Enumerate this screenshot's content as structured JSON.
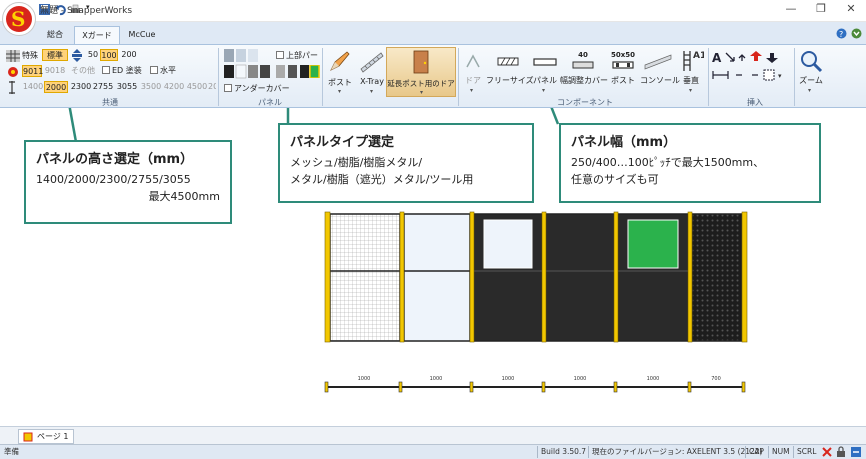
{
  "window": {
    "title": "無題 - SnapperWorks",
    "controls": [
      "minimize",
      "restore",
      "close"
    ]
  },
  "tabs": [
    {
      "label": "総合",
      "active": false
    },
    {
      "label": "Xガード",
      "active": true
    },
    {
      "label": "McCue",
      "active": false
    }
  ],
  "ribbon": {
    "common": {
      "row1": [
        "特殊",
        "標準",
        "50",
        "100",
        "200"
      ],
      "row2": [
        "9011",
        "9018",
        "その他"
      ],
      "row2_checks": [
        "ED 塗装",
        "水平"
      ],
      "heights": [
        "1400",
        "2000",
        "2300",
        "2755",
        "3055",
        "3500",
        "4200",
        "4500",
        "2000..."
      ],
      "selected_height": "2000",
      "group_label": "共通"
    },
    "panel": {
      "check_top": "上部パー",
      "check_under": "アンダーカバー",
      "group_label": "パネル"
    },
    "buttons": {
      "post": "ポスト",
      "xtray": "X-Tray",
      "ext_door": "延長ポスト用のドア"
    },
    "component": {
      "door": "ドア",
      "free_size": "フリーサイズ",
      "panel": "パネル",
      "width_adjust": "幅調整カバー",
      "post": "ポスト",
      "console": "コンソール",
      "vertical": "垂直",
      "badge_40": "40",
      "badge_50x50": "50x50",
      "group_label": "コンポーネント"
    },
    "insert": {
      "group_label": "挿入"
    },
    "zoom": {
      "label": "ズーム"
    }
  },
  "callouts": [
    {
      "heading": "パネルの高さ選定（mm）",
      "lines": [
        "1400/2000/2300/2755/3055",
        "最大4500mm"
      ]
    },
    {
      "heading": "パネルタイプ選定",
      "lines": [
        "メッシュ/樹脂/樹脂メタル/",
        "メタル/樹脂（遮光）メタル/ツール用"
      ]
    },
    {
      "heading": "パネル幅（mm）",
      "lines": [
        "250/400…100ﾋﾟｯﾁで最大1500mm、",
        "任意のサイズも可"
      ]
    }
  ],
  "drawing": {
    "dimensions": [
      "1000",
      "1000",
      "1000",
      "1000",
      "1000",
      "700"
    ]
  },
  "page_tab": "ページ 1",
  "status": {
    "left": "準備",
    "build": "Build 3.50.7",
    "file_version": "現在のファイルバージョン: AXELENT 3.5 (2122)",
    "indicators": [
      "CAP",
      "NUM",
      "SCRL"
    ]
  },
  "colors": {
    "accent": "#2e8b7a",
    "ribbon": "#dfe9f5",
    "post_yellow": "#f2c700",
    "panel_green": "#2bb24c"
  }
}
